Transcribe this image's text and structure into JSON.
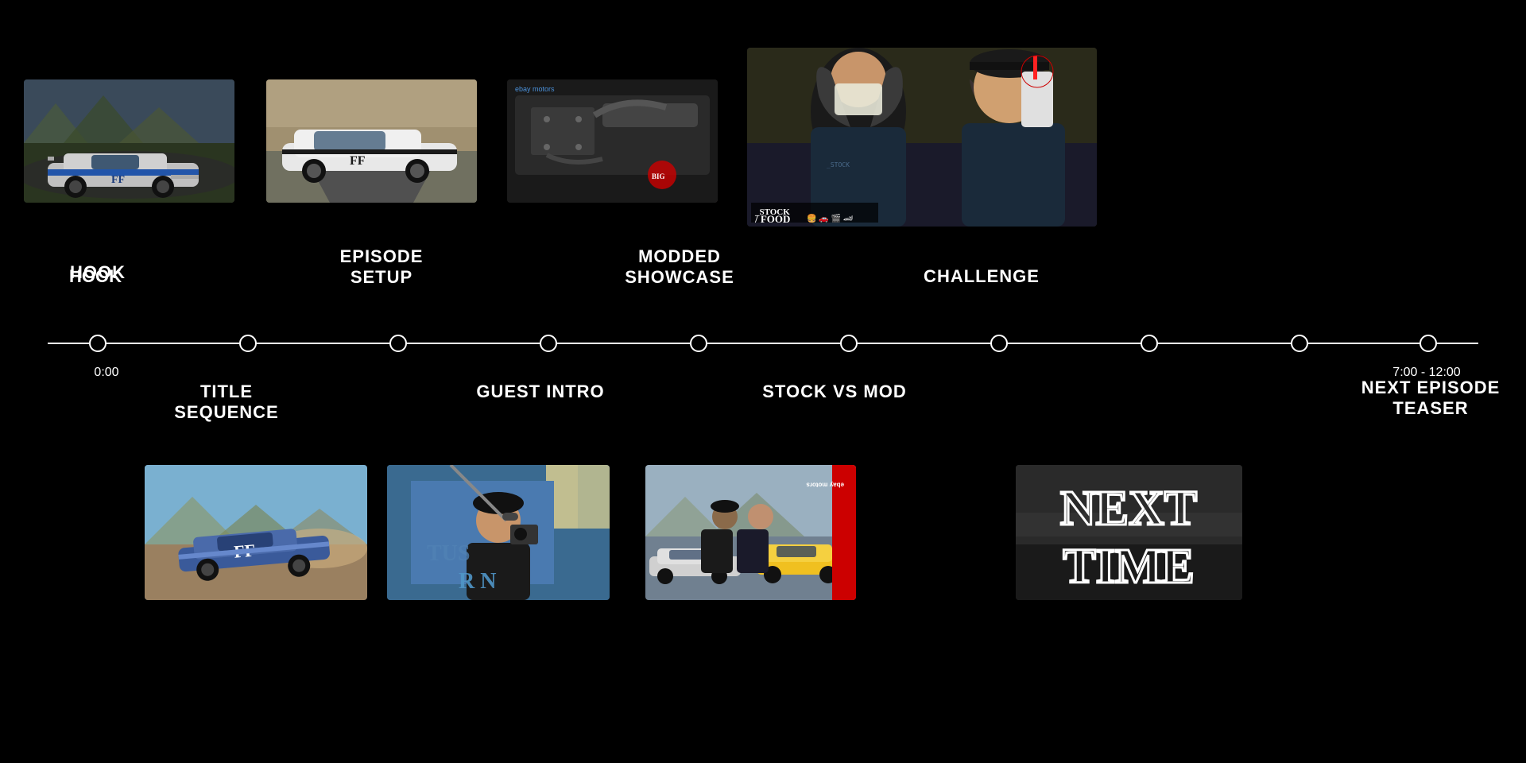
{
  "timeline": {
    "nodes": [
      {
        "id": "node-0",
        "x_pct": 3.5,
        "label_above": null,
        "label_below": null,
        "time": "0:00",
        "time_pos": "below"
      },
      {
        "id": "node-1",
        "x_pct": 14,
        "label_above": null,
        "label_below": "TITLE\nSEQUENCE",
        "time": null
      },
      {
        "id": "node-2",
        "x_pct": 24.5,
        "label_above": "EPISODE\nSETUP",
        "label_below": null,
        "time": null
      },
      {
        "id": "node-3",
        "x_pct": 35,
        "label_above": null,
        "label_below": "GUEST INTRO",
        "time": null
      },
      {
        "id": "node-4",
        "x_pct": 45.5,
        "label_above": "MODDED\nSHOWCASE",
        "label_below": null,
        "time": null
      },
      {
        "id": "node-5",
        "x_pct": 56,
        "label_above": null,
        "label_below": "STOCK VS MOD",
        "time": null
      },
      {
        "id": "node-6",
        "x_pct": 66.5,
        "label_above": "CHALLENGE",
        "label_below": null,
        "time": null
      },
      {
        "id": "node-7",
        "x_pct": 77,
        "label_above": null,
        "label_below": null,
        "time": null
      },
      {
        "id": "node-8",
        "x_pct": 87.5,
        "label_above": null,
        "label_below": null,
        "time": null
      },
      {
        "id": "node-9",
        "x_pct": 96.5,
        "label_above": null,
        "label_below": "NEXT EPISODE\nTEASER",
        "time": "7:00 - 12:00"
      }
    ],
    "labels": {
      "hook": "HOOK",
      "title_sequence": "TITLE\nSEQUENCE",
      "episode_setup": "EPISODE\nSETUP",
      "guest_intro": "GUEST INTRO",
      "modded_showcase": "MODDED\nSHOWCASE",
      "stock_vs_mod": "STOCK VS MOD",
      "challenge": "CHALLENGE",
      "next_episode_teaser": "NEXT EPISODE\nTEASER",
      "time_start": "0:00",
      "time_end": "7:00 - 12:00"
    }
  },
  "thumbnails": {
    "top": [
      {
        "id": "hook",
        "label": "hook-thumb"
      },
      {
        "id": "episode-setup",
        "label": "episode-setup-thumb"
      },
      {
        "id": "modded-showcase",
        "label": "modded-showcase-thumb"
      },
      {
        "id": "challenge",
        "label": "challenge-thumb"
      }
    ],
    "bottom": [
      {
        "id": "title-sequence",
        "label": "title-sequence-thumb"
      },
      {
        "id": "guest-intro",
        "label": "guest-intro-thumb"
      },
      {
        "id": "stock-vs-mod",
        "label": "stock-vs-mod-thumb"
      },
      {
        "id": "next-episode-teaser",
        "label": "next-episode-teaser-thumb"
      }
    ]
  },
  "next_time": {
    "line1": "NEXT",
    "line2": "TIME"
  },
  "ebay_motors": "ebay\nmotors",
  "stock_food_label": "STOCK\nFOOD"
}
